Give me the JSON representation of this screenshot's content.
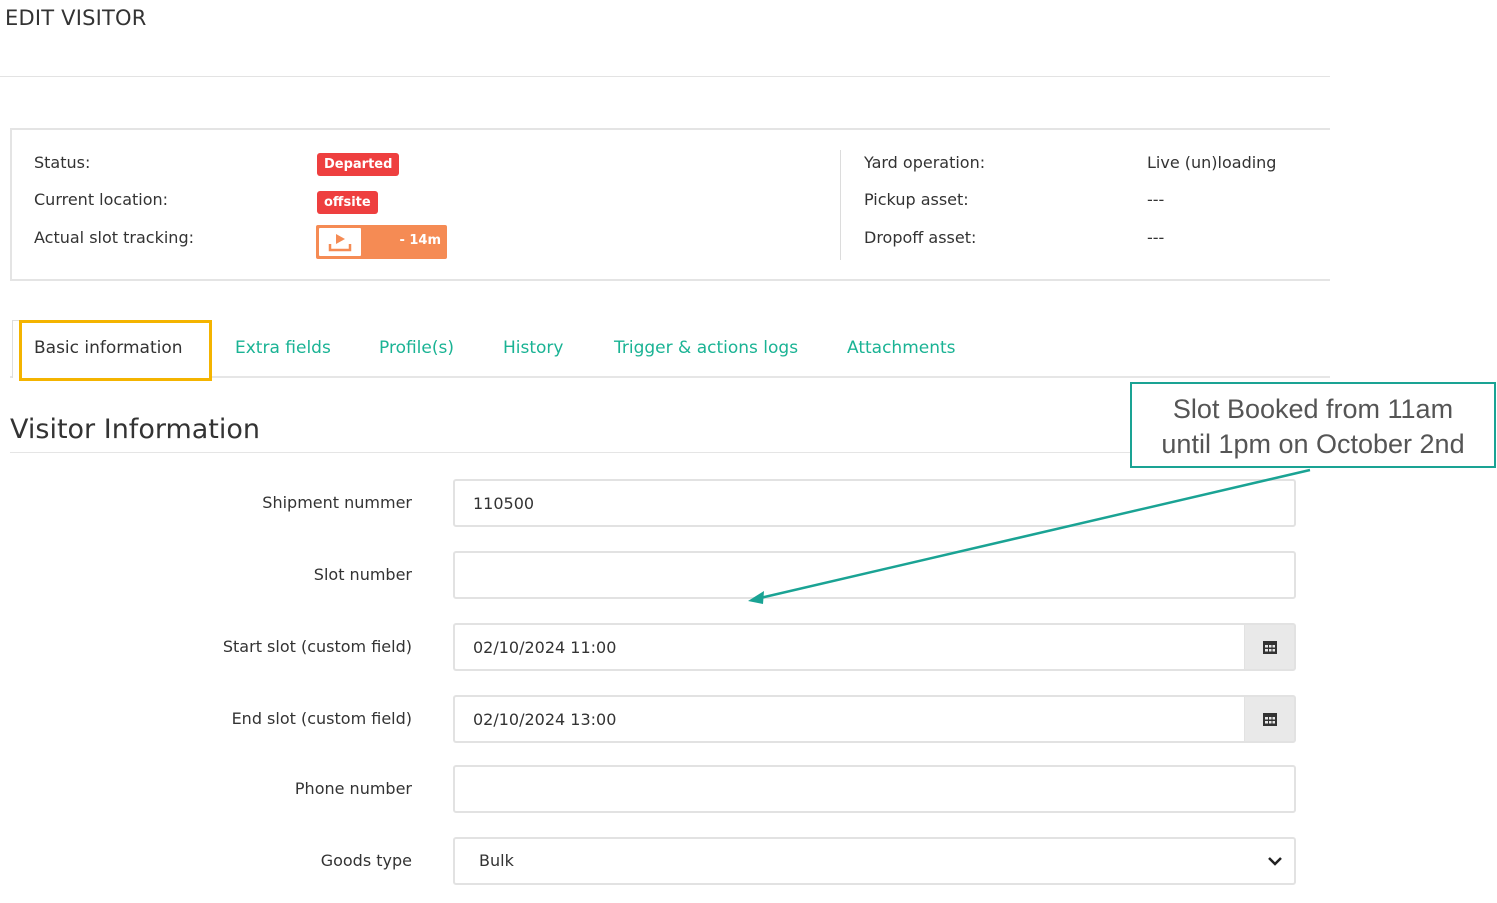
{
  "page": {
    "title": "EDIT VISITOR"
  },
  "summary": {
    "status_label": "Status:",
    "status_value": "Departed",
    "location_label": "Current location:",
    "location_value": "offsite",
    "tracking_label": "Actual slot tracking:",
    "tracking_value": "- 14m",
    "yard_label": "Yard operation:",
    "yard_value": "Live (un)loading",
    "pickup_label": "Pickup asset:",
    "pickup_value": "---",
    "dropoff_label": "Dropoff asset:",
    "dropoff_value": "---",
    "colors": {
      "badge": "#ee3f3f",
      "tracking": "#f58b54"
    }
  },
  "tabs": [
    {
      "label": "Basic information",
      "active": true
    },
    {
      "label": "Extra fields"
    },
    {
      "label": "Profile(s)"
    },
    {
      "label": "History"
    },
    {
      "label": "Trigger & actions logs"
    },
    {
      "label": "Attachments"
    }
  ],
  "section": {
    "title": "Visitor Information"
  },
  "form": {
    "shipment_label": "Shipment nummer",
    "shipment_value": "110500",
    "slot_label": "Slot number",
    "slot_value": "",
    "start_label": "Start slot (custom field)",
    "start_value": "02/10/2024 11:00",
    "end_label": "End slot (custom field)",
    "end_value": "02/10/2024 13:00",
    "phone_label": "Phone number",
    "phone_value": "",
    "goods_label": "Goods type",
    "goods_value": "Bulk"
  },
  "annotation": {
    "line1": "Slot Booked from 11am",
    "line2": "until 1pm on October 2nd",
    "color": "#1aa394",
    "highlight_color": "#f4b400"
  },
  "icons": {
    "tracking": "unload-icon",
    "calendar": "calendar-icon",
    "select": "chevron-down-icon"
  }
}
